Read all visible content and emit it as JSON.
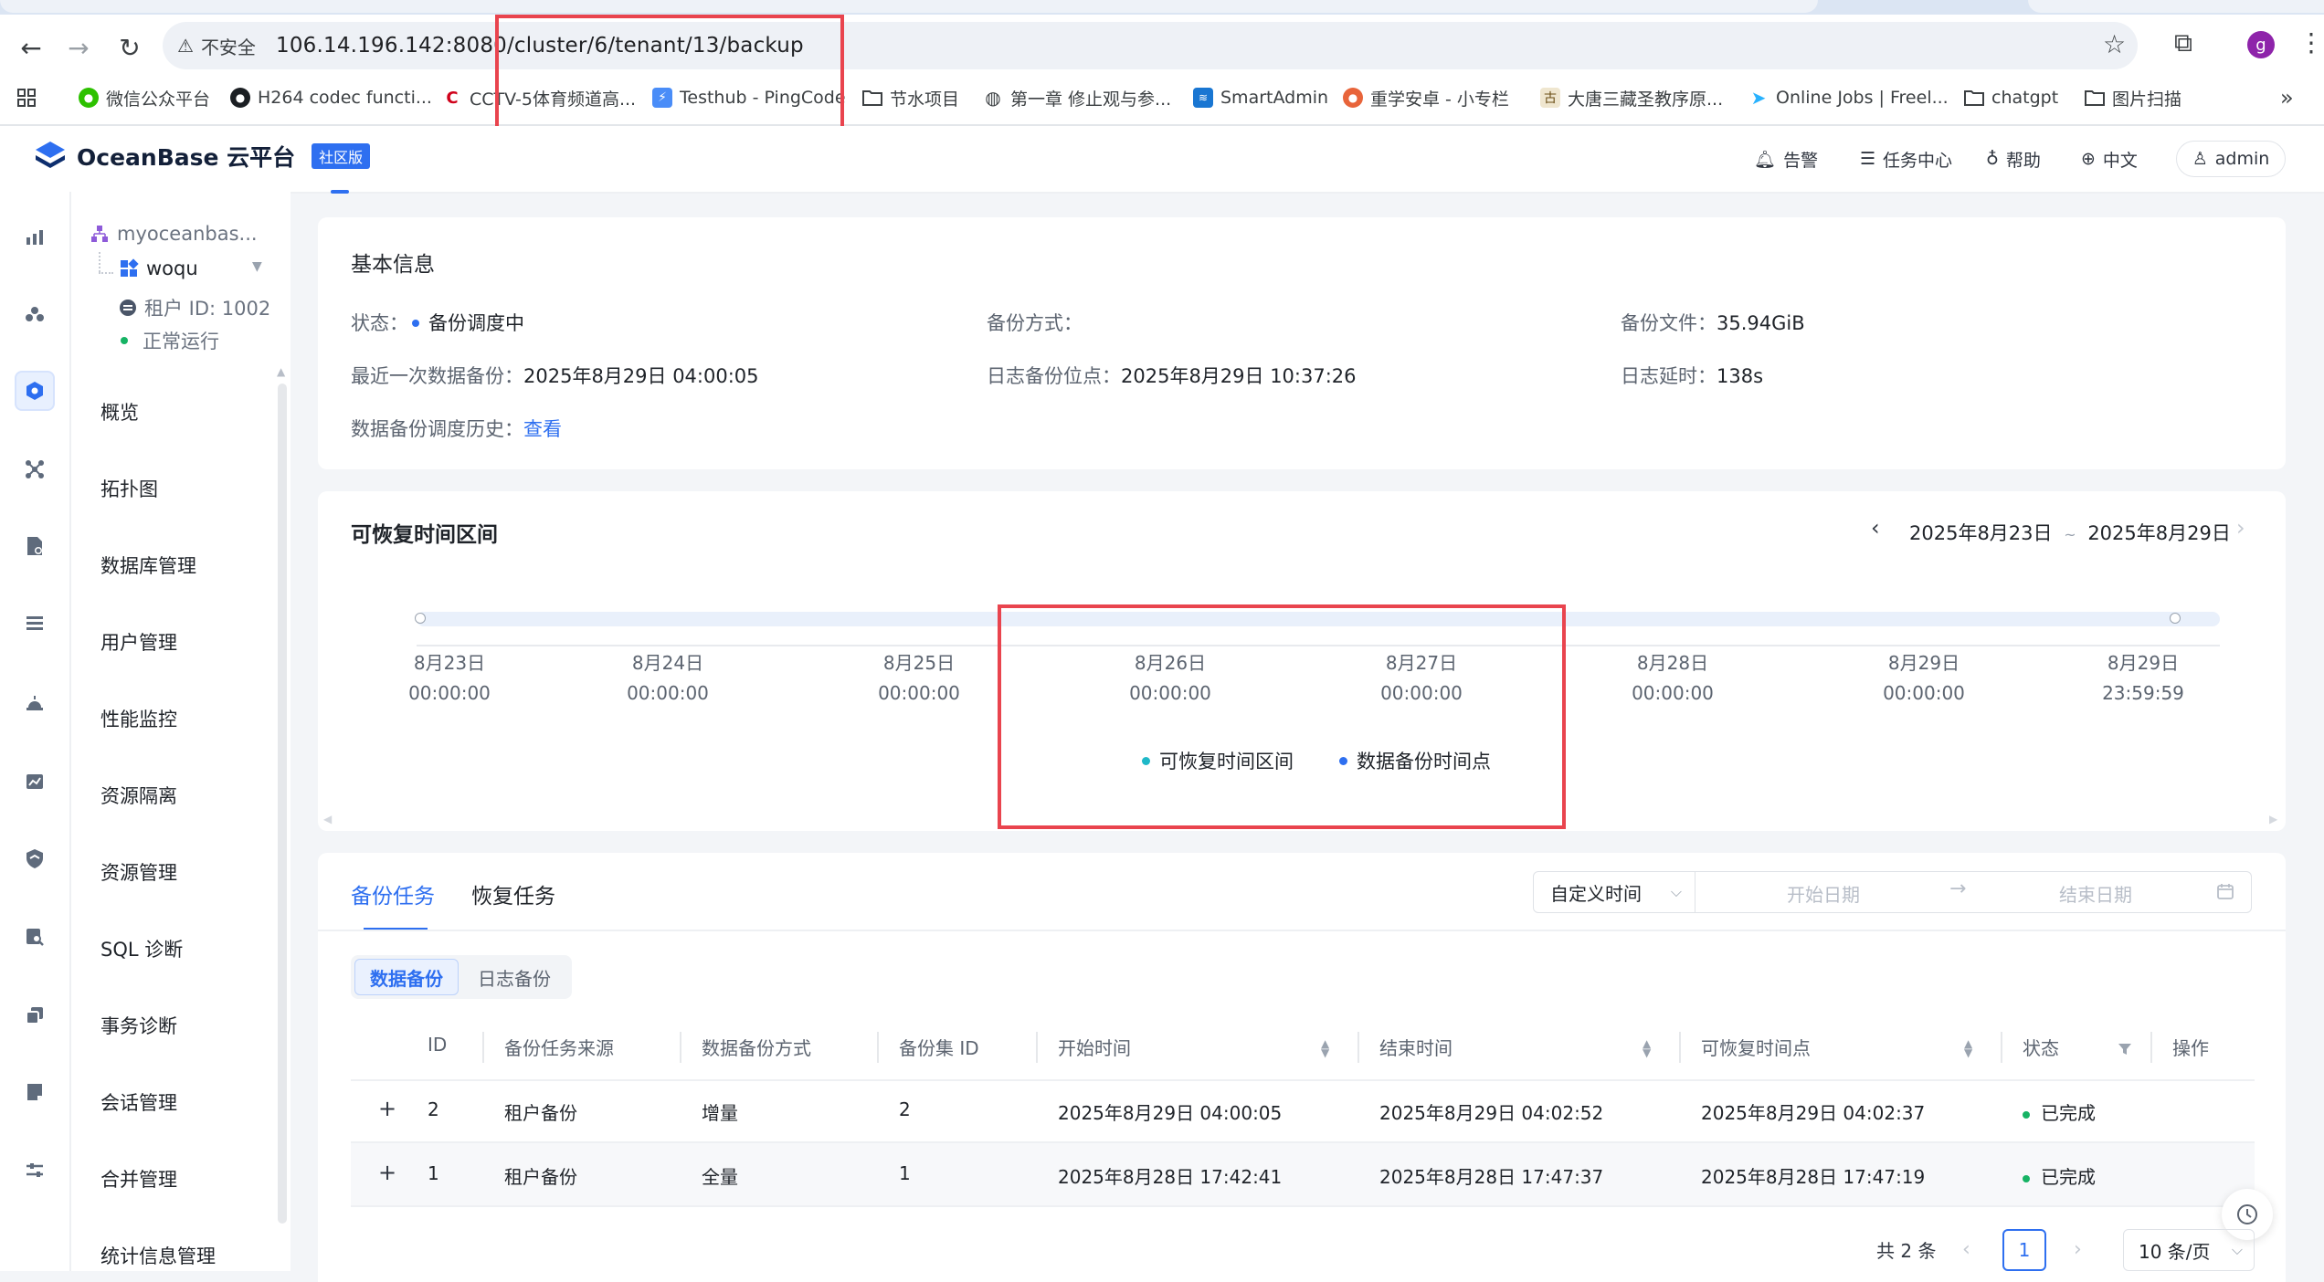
{
  "browser": {
    "insecure_label": "不安全",
    "url": "106.14.196.142:8080/cluster/6/tenant/13/backup",
    "profile_initial": "g",
    "bookmarks": [
      {
        "label": "微信公众平台",
        "icon": "wechat-icon"
      },
      {
        "label": "H264 codec functi...",
        "icon": "github-icon"
      },
      {
        "label": "CCTV-5体育频道高...",
        "icon": "cctv-icon"
      },
      {
        "label": "Testhub - PingCode",
        "icon": "pingcode-icon"
      },
      {
        "label": "节水项目",
        "icon": "folder-icon"
      },
      {
        "label": "第一章 修止观与参...",
        "icon": "globe-icon"
      },
      {
        "label": "SmartAdmin",
        "icon": "smartadmin-icon"
      },
      {
        "label": "重学安卓 - 小专栏",
        "icon": "xiaozhuanlan-icon"
      },
      {
        "label": "大唐三藏圣教序原...",
        "icon": "book-icon"
      },
      {
        "label": "Online Jobs | Freel...",
        "icon": "freelancer-icon"
      },
      {
        "label": "chatgpt",
        "icon": "folder-icon"
      },
      {
        "label": "图片扫描",
        "icon": "folder-icon"
      }
    ]
  },
  "header": {
    "logo_text": "OceanBase 云平台",
    "edition_badge": "社区版",
    "alerts": "告警",
    "task_center": "任务中心",
    "help": "帮助",
    "language": "中文",
    "user": "admin"
  },
  "sidebar": {
    "cluster_name": "myoceanbas...",
    "tenant_name": "woqu",
    "tenant_id": "租户 ID: 1002",
    "tenant_status": "正常运行",
    "menu": [
      "概览",
      "拓扑图",
      "数据库管理",
      "用户管理",
      "性能监控",
      "资源隔离",
      "资源管理",
      "SQL 诊断",
      "事务诊断",
      "会话管理",
      "合并管理",
      "统计信息管理"
    ]
  },
  "basic_info": {
    "title": "基本信息",
    "status_label": "状态：",
    "status_value": "备份调度中",
    "backup_mode_label": "备份方式：",
    "backup_mode_value": "",
    "backup_file_label": "备份文件：",
    "backup_file_value": "35.94GiB",
    "last_backup_label": "最近一次数据备份：",
    "last_backup_value": "2025年8月29日 04:00:05",
    "log_position_label": "日志备份位点：",
    "log_position_value": "2025年8月29日 10:37:26",
    "log_delay_label": "日志延时：",
    "log_delay_value": "138s",
    "history_label": "数据备份调度历史：",
    "history_link": "查看"
  },
  "recovery": {
    "title": "可恢复时间区间",
    "range_start": "2025年8月23日",
    "range_sep": "~",
    "range_end": "2025年8月29日",
    "ticks": [
      {
        "date": "8月23日",
        "time": "00:00:00"
      },
      {
        "date": "8月24日",
        "time": "00:00:00"
      },
      {
        "date": "8月25日",
        "time": "00:00:00"
      },
      {
        "date": "8月26日",
        "time": "00:00:00"
      },
      {
        "date": "8月27日",
        "time": "00:00:00"
      },
      {
        "date": "8月28日",
        "time": "00:00:00"
      },
      {
        "date": "8月29日",
        "time": "00:00:00"
      },
      {
        "date": "8月29日",
        "time": "23:59:59"
      }
    ],
    "legend_recoverable": "可恢复时间区间",
    "legend_backup_point": "数据备份时间点",
    "color_recoverable": "#1fb8c8",
    "color_backup_point": "#2e6ff0"
  },
  "tasks": {
    "tab_backup": "备份任务",
    "tab_restore": "恢复任务",
    "time_filter": "自定义时间",
    "start_placeholder": "开始日期",
    "end_placeholder": "结束日期",
    "seg_data": "数据备份",
    "seg_log": "日志备份",
    "columns": [
      "ID",
      "备份任务来源",
      "数据备份方式",
      "备份集 ID",
      "开始时间",
      "结束时间",
      "可恢复时间点",
      "状态",
      "操作"
    ],
    "rows": [
      {
        "id": "2",
        "source": "租户备份",
        "mode": "增量",
        "set_id": "2",
        "start": "2025年8月29日 04:00:05",
        "end": "2025年8月29日 04:02:52",
        "recoverable": "2025年8月29日 04:02:37",
        "status": "已完成"
      },
      {
        "id": "1",
        "source": "租户备份",
        "mode": "全量",
        "set_id": "1",
        "start": "2025年8月28日 17:42:41",
        "end": "2025年8月28日 17:47:37",
        "recoverable": "2025年8月28日 17:47:19",
        "status": "已完成"
      }
    ],
    "total": "共 2 条",
    "current_page": "1",
    "page_size": "10 条/页"
  }
}
